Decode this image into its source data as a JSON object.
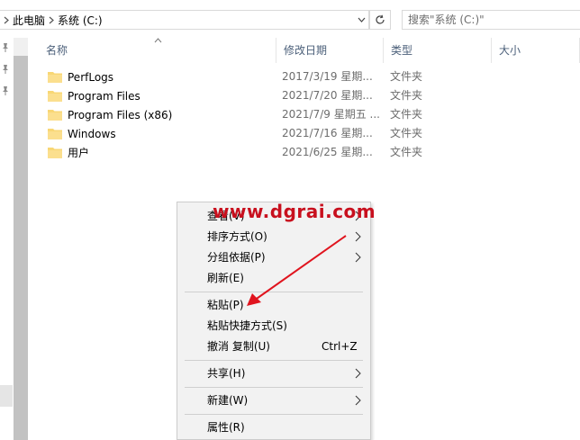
{
  "address_bar": {
    "breadcrumb": [
      "此电脑",
      "系统 (C:)"
    ]
  },
  "search": {
    "placeholder": "搜索\"系统 (C:)\""
  },
  "columns": {
    "name": "名称",
    "date": "修改日期",
    "type": "类型",
    "size": "大小"
  },
  "files": [
    {
      "name": "PerfLogs",
      "date": "2017/3/19 星期...",
      "type": "文件夹"
    },
    {
      "name": "Program Files",
      "date": "2021/7/20 星期...",
      "type": "文件夹"
    },
    {
      "name": "Program Files (x86)",
      "date": "2021/7/9 星期五 ...",
      "type": "文件夹"
    },
    {
      "name": "Windows",
      "date": "2021/7/16 星期...",
      "type": "文件夹"
    },
    {
      "name": "用户",
      "date": "2021/6/25 星期...",
      "type": "文件夹"
    }
  ],
  "context_menu": {
    "items": [
      {
        "label": "查看(V)",
        "submenu": true
      },
      {
        "label": "排序方式(O)",
        "submenu": true
      },
      {
        "label": "分组依据(P)",
        "submenu": true
      },
      {
        "label": "刷新(E)",
        "submenu": false
      },
      {
        "label": "粘贴(P)",
        "submenu": false
      },
      {
        "label": "粘贴快捷方式(S)",
        "submenu": false
      },
      {
        "label": "撤消 复制(U)",
        "shortcut": "Ctrl+Z",
        "submenu": false
      },
      {
        "label": "共享(H)",
        "submenu": true
      },
      {
        "label": "新建(W)",
        "submenu": true
      },
      {
        "label": "属性(R)",
        "submenu": false
      }
    ]
  },
  "watermark": "www.dgrai.com",
  "colors": {
    "folder": "#f8d775",
    "accent_red": "#e0141e",
    "header_text": "#4c607a"
  }
}
